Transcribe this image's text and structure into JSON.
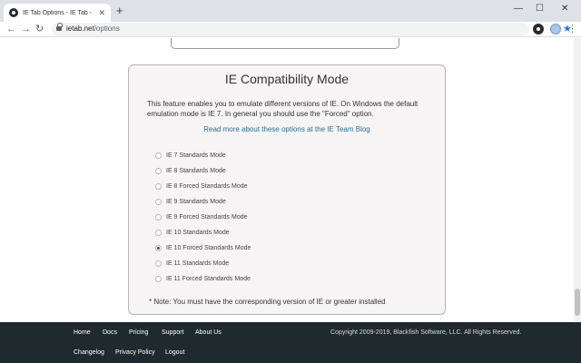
{
  "browser": {
    "tab_title": "IE Tab Options - IE Tab - Run Inte",
    "tab_close": "✕",
    "new_tab": "+",
    "minimize": "—",
    "maximize": "☐",
    "close": "✕",
    "back": "←",
    "forward": "→",
    "reload": "↻",
    "url_host": "ietab.net",
    "url_path": "/options",
    "bookmark_star": "★",
    "menu": "⋮"
  },
  "panel": {
    "title": "IE Compatibility Mode",
    "description": "This feature enables you to emulate different versions of IE. On Windows the default emulation mode is IE 7. In general you should use the \"Forced\" option.",
    "link": "Read more about these options at the IE Team Blog",
    "options": [
      {
        "label": "IE 7 Standards Mode",
        "checked": false
      },
      {
        "label": "IE 8 Standards Mode",
        "checked": false
      },
      {
        "label": "IE 8 Forced Standards Mode",
        "checked": false
      },
      {
        "label": "IE 9 Standards Mode",
        "checked": false
      },
      {
        "label": "IE 9 Forced Standards Mode",
        "checked": false
      },
      {
        "label": "IE 10 Standards Mode",
        "checked": false
      },
      {
        "label": "IE 10 Forced Standards Mode",
        "checked": true
      },
      {
        "label": "IE 11 Standards Mode",
        "checked": false
      },
      {
        "label": "IE 11 Forced Standards Mode",
        "checked": false
      }
    ],
    "note": "* Note: You must have the corresponding version of IE or greater installed"
  },
  "footer": {
    "links_row1": [
      "Home",
      "Docs",
      "Pricing",
      "Support",
      "About Us"
    ],
    "links_row2": [
      "Changelog",
      "Privacy Policy",
      "Logout"
    ],
    "copyright": "Copyright 2009-2019, Blackfish Software, LLC. All Rights Reserved."
  },
  "colors": {
    "panel_bg": "#f7f4f6",
    "link": "#2a6f8f",
    "footer_bg": "#1f2a2e",
    "accent": "#1a73e8"
  }
}
